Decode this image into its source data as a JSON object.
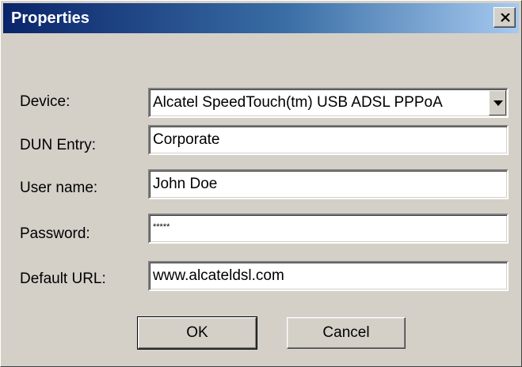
{
  "dialog": {
    "title": "Properties"
  },
  "form": {
    "device": {
      "label": "Device:",
      "value": "Alcatel SpeedTouch(tm) USB ADSL PPPoA"
    },
    "dun_entry": {
      "label": "DUN Entry:",
      "value": "Corporate"
    },
    "user_name": {
      "label": "User name:",
      "value": "John Doe"
    },
    "password": {
      "label": "Password:",
      "value": "*****"
    },
    "default_url": {
      "label": "Default URL:",
      "value": "www.alcateldsl.com"
    }
  },
  "buttons": {
    "ok_label": "OK",
    "cancel_label": "Cancel"
  },
  "icons": {
    "close": "close-icon",
    "dropdown": "chevron-down-icon"
  },
  "colors": {
    "titlebar_start": "#0a246a",
    "titlebar_end": "#a6caf0",
    "face": "#d4d0c8"
  }
}
